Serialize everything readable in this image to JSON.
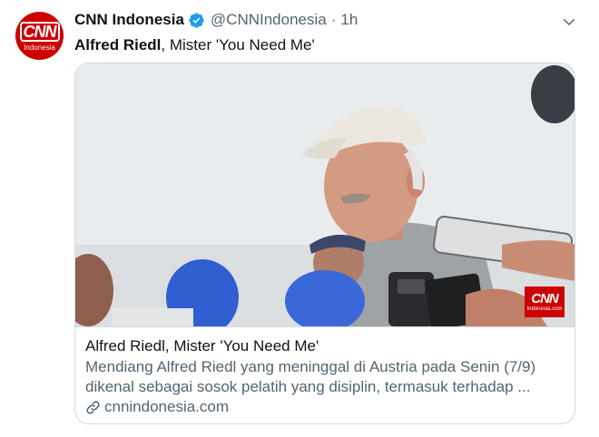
{
  "account": {
    "display_name": "CNN Indonesia",
    "handle": "@CNNIndonesia",
    "separator": "·",
    "time": "1h",
    "avatar_logo": "CNN",
    "avatar_sub": "Indonesia"
  },
  "tweet": {
    "text_bold": "Alfred Riedl",
    "text_rest": ", Mister 'You Need Me'"
  },
  "card": {
    "title": "Alfred Riedl, Mister 'You Need Me'",
    "description_line1": "Mendiang Alfred Riedl yang meninggal di Austria pada Senin (7/9)",
    "description_line2": "dikenal sebagai sosok pelatih yang disiplin, termasuk terhadap ...",
    "domain": "cnnindonesia.com",
    "watermark_logo": "CNN",
    "watermark_sub": "Indonesia.com"
  },
  "icons": {
    "verified": "verified-badge-icon",
    "more": "chevron-down-icon",
    "link": "link-icon"
  },
  "colors": {
    "brand_red": "#cc0000",
    "verified_blue": "#1d9bf0",
    "secondary_text": "#536471",
    "border": "#cfd9de"
  }
}
